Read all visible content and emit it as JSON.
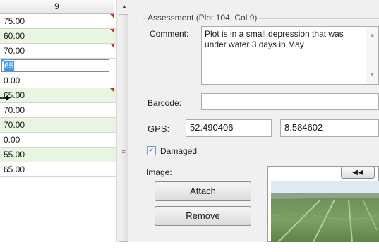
{
  "grid": {
    "column_header": "9",
    "rows": [
      {
        "value": "75.00",
        "style": "white",
        "flag": true
      },
      {
        "value": "60.00",
        "style": "green",
        "flag": true
      },
      {
        "value": "70.00",
        "style": "white",
        "flag": true
      },
      {
        "value": "65",
        "style": "editing",
        "flag": false
      },
      {
        "value": "0.00",
        "style": "white",
        "flag": false
      },
      {
        "value": "65.00",
        "style": "green",
        "flag": true
      },
      {
        "value": "70.00",
        "style": "white",
        "flag": false
      },
      {
        "value": "70.00",
        "style": "green",
        "flag": false
      },
      {
        "value": "0.00",
        "style": "white",
        "flag": false
      },
      {
        "value": "55.00",
        "style": "green",
        "flag": false
      },
      {
        "value": "65.00",
        "style": "white",
        "flag": false
      }
    ]
  },
  "scrollbar": {
    "up_icon": "triangle-up-icon",
    "grip_icon": "grip-lines-icon"
  },
  "assessment": {
    "title": "Assessment (Plot  104, Col  9)",
    "comment_label": "Comment:",
    "comment_value": "Plot is in a small depression that was under water 3 days in May",
    "barcode_label": "Barcode:",
    "barcode_value": "",
    "gps_label": "GPS:",
    "gps_lat": "52.490406",
    "gps_lon": "8.584602",
    "damaged_label": "Damaged",
    "damaged_checked": true,
    "image_label": "Image:",
    "attach_label": "Attach",
    "remove_label": "Remove",
    "image_nav_icon": "double-left-arrow-icon"
  },
  "colors": {
    "flag": "#e0201c",
    "green_row": "#e7f5e1",
    "selection": "#3399ff"
  }
}
